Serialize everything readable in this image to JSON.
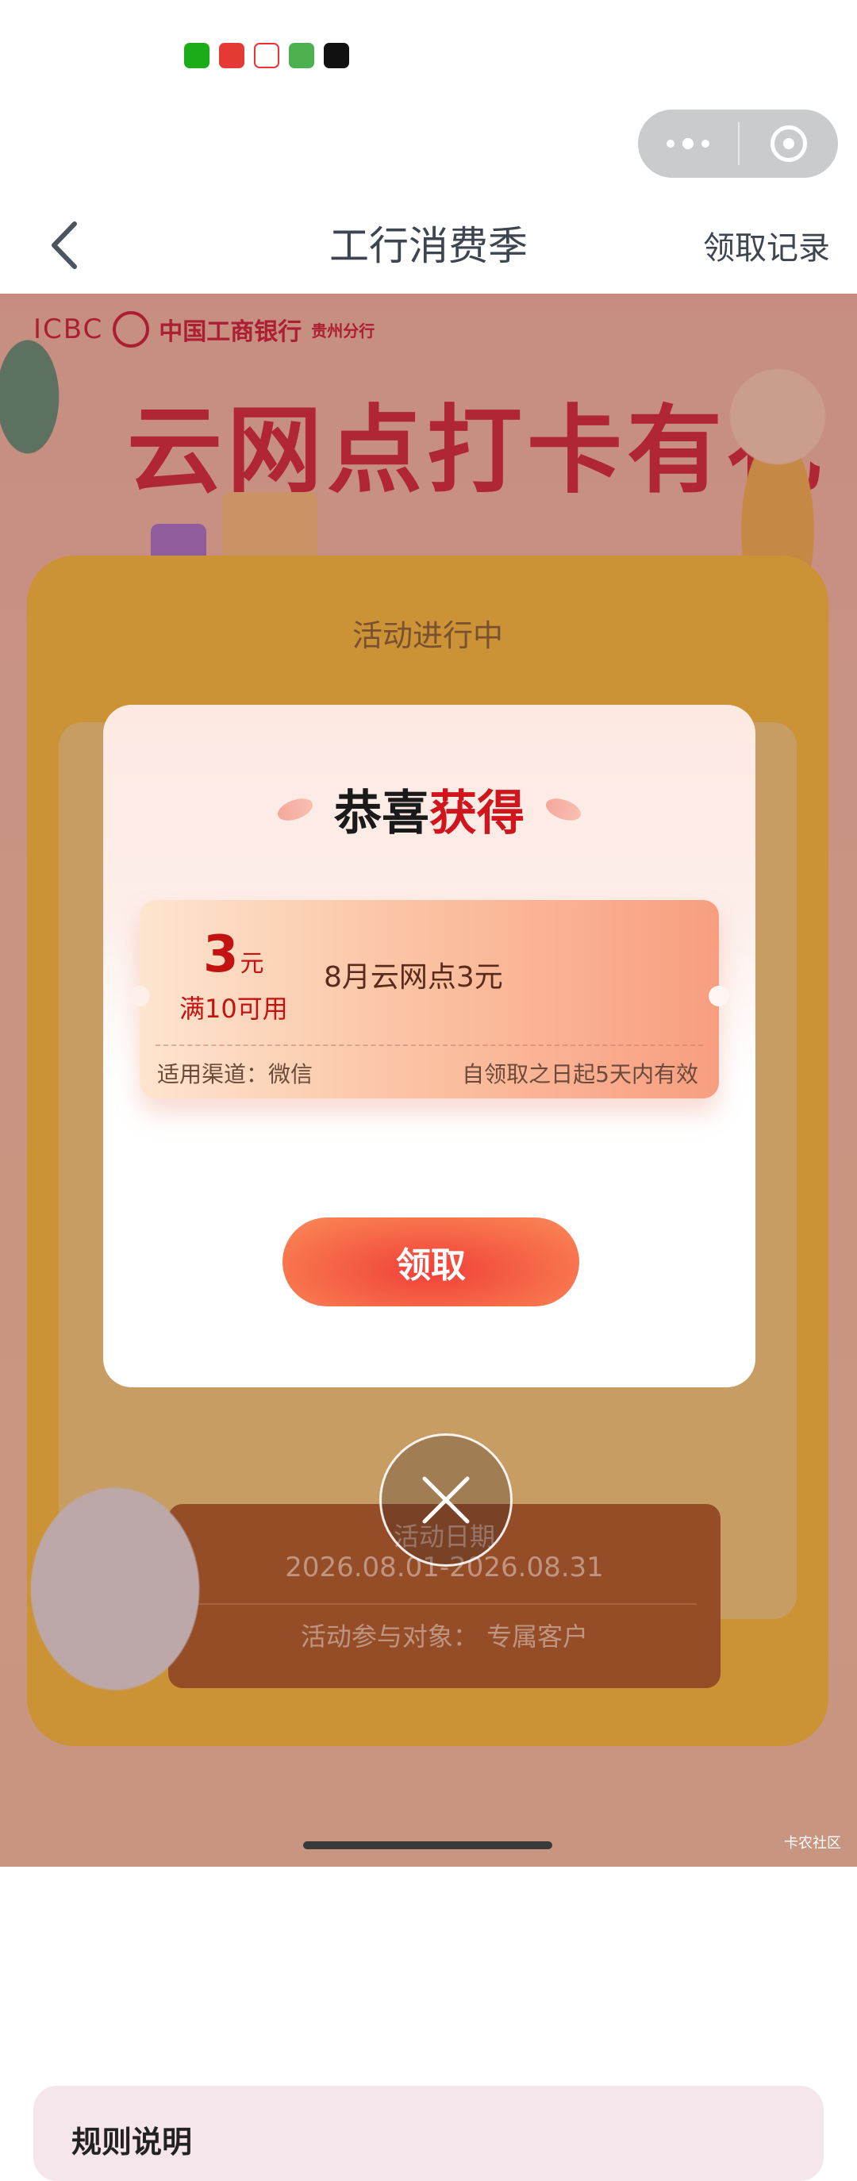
{
  "status_bar": {
    "app_icons": [
      {
        "name": "wechat-icon",
        "color": "#1aad19"
      },
      {
        "name": "app-icon",
        "color": "#e53935"
      },
      {
        "name": "toutiao-icon",
        "color": "#f5f5f5"
      },
      {
        "name": "app-icon",
        "color": "#4caf50"
      },
      {
        "name": "tiktok-icon",
        "color": "#111111"
      }
    ]
  },
  "capsule": {
    "more_icon": "more-dots-icon",
    "close_icon": "target-icon"
  },
  "nav": {
    "back_icon": "chevron-left-icon",
    "title": "工行消费季",
    "record_link": "领取记录"
  },
  "page": {
    "logo_text": "ICBC",
    "bank_name": "中国工商银行",
    "branch": "贵州分行",
    "hero_title": "云网点打卡有礼",
    "progress_label": "活动进行中",
    "date_label": "活动日期",
    "date_range": "2026.08.01-2026.08.31",
    "target_label": "活动参与对象：  专属客户",
    "rules_title": "规则说明"
  },
  "modal": {
    "title_part1": "恭喜",
    "title_part2": "获得",
    "coupon": {
      "amount": "3",
      "unit": "元",
      "condition": "满10可用",
      "name": "8月云网点3元",
      "channel": "适用渠道：微信",
      "validity": "自领取之日起5天内有效"
    },
    "claim_button": "领取",
    "close_icon": "close-icon"
  },
  "watermark": "卡农社区",
  "colors": {
    "accent_red": "#d0151c",
    "button_red": "#f0403a",
    "nav_text": "#3d4650"
  }
}
